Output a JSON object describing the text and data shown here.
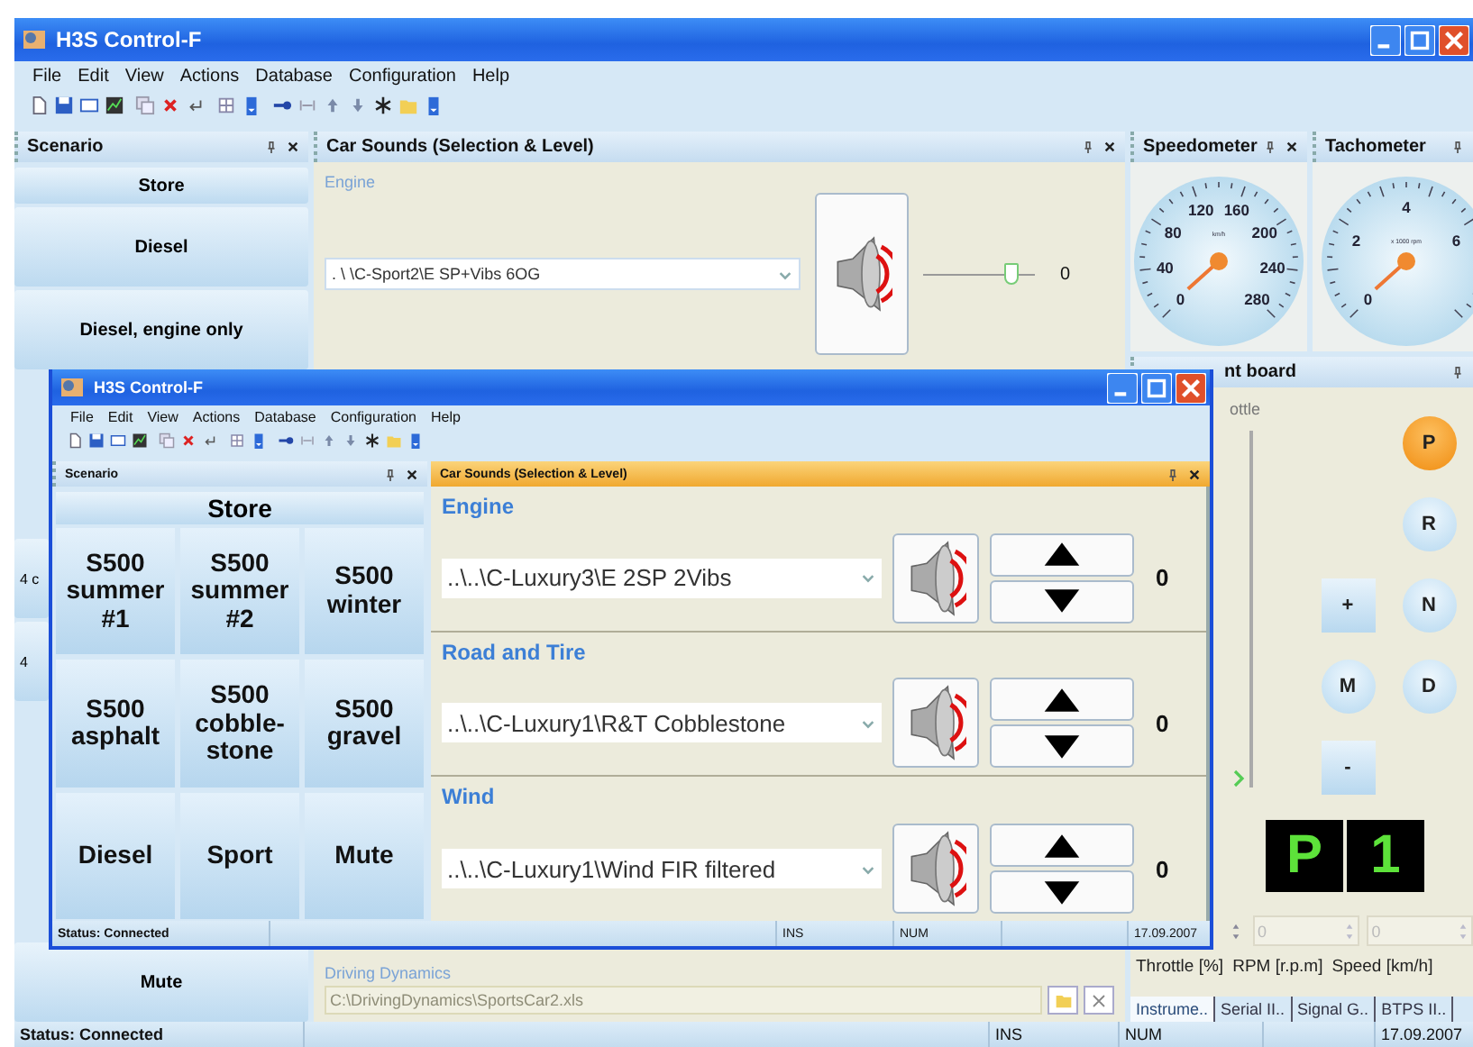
{
  "window": {
    "title": "H3S Control-F"
  },
  "menu": [
    "File",
    "Edit",
    "View",
    "Actions",
    "Database",
    "Configuration",
    "Help"
  ],
  "scenario_panel": {
    "title": "Scenario",
    "buttons": [
      {
        "label": "Store",
        "kind": "store"
      },
      {
        "label": "Diesel",
        "kind": "preset"
      },
      {
        "label": "Diesel, engine only",
        "kind": "preset"
      },
      {
        "label": "4 c",
        "kind": "partial"
      },
      {
        "label": "4",
        "kind": "partial"
      },
      {
        "label": "Mute",
        "kind": "last"
      }
    ]
  },
  "car_sounds_panel": {
    "title": "Car Sounds  (Selection & Level)",
    "channels": [
      {
        "name": "Engine",
        "file": ". \\ \\C-Sport2\\E SP+Vibs 6OG",
        "level": 0.85,
        "reading": "0"
      }
    ],
    "driving_dynamics": {
      "label": "Driving Dynamics",
      "path": "C:\\DrivingDynamics\\SportsCar2.xls"
    }
  },
  "speedometer": {
    "title": "Speedometer",
    "unit": "km/h",
    "labels": [
      "0",
      "40",
      "80",
      "120",
      "160",
      "200",
      "240",
      "280"
    ]
  },
  "tachometer": {
    "title": "Tachometer",
    "unit": "x 1000 rpm",
    "labels": [
      "0",
      "2",
      "4",
      "6"
    ]
  },
  "instrument_board": {
    "title": "nt board",
    "throttle": {
      "label": "ottle",
      "level": 0
    },
    "gear_buttons": [
      {
        "label": "P",
        "kind": "round",
        "selected": true
      },
      {
        "label": "R",
        "kind": "round",
        "selected": false
      },
      {
        "label": "+",
        "kind": "square",
        "selected": false
      },
      {
        "label": "N",
        "kind": "round",
        "selected": false
      },
      {
        "label": "M",
        "kind": "round",
        "selected": false
      },
      {
        "label": "D",
        "kind": "round",
        "selected": false
      },
      {
        "label": "-",
        "kind": "square",
        "selected": false
      }
    ],
    "display": [
      "P",
      "1"
    ],
    "fields": [
      {
        "value": "0"
      },
      {
        "value": "0"
      }
    ],
    "field_labels": [
      "Throttle [%]",
      "RPM [r.p.m]",
      "Speed [km/h]"
    ],
    "tabs": [
      {
        "label": "Instrume..",
        "selected": true
      },
      {
        "label": "Serial II..",
        "selected": false
      },
      {
        "label": "Signal G..",
        "selected": false
      },
      {
        "label": "BTPS II..",
        "selected": false
      }
    ]
  },
  "status_bar": {
    "status": "Status: Connected",
    "cells": [
      "INS",
      "NUM",
      "17.09.2007"
    ]
  },
  "front_window": {
    "title": "H3S Control-F",
    "menu": [
      "File",
      "Edit",
      "View",
      "Actions",
      "Database",
      "Configuration",
      "Help"
    ],
    "scenario_panel": {
      "title": "Scenario",
      "store": "Store",
      "buttons": [
        "S500\nsummer\n#1",
        "S500\nsummer\n#2",
        "S500\nwinter",
        "S500\nasphalt",
        "S500\ncobble-\nstone",
        "S500\ngravel",
        "Diesel",
        "Sport",
        "Mute"
      ]
    },
    "car_sounds_panel": {
      "title": "Car Sounds  (Selection & Level)",
      "channels": [
        {
          "name": "Engine",
          "file": "..\\..\\C-Luxury3\\E 2SP 2Vibs",
          "reading": "0"
        },
        {
          "name": "Road and Tire",
          "file": "..\\..\\C-Luxury1\\R&T Cobblestone",
          "reading": "0"
        },
        {
          "name": "Wind",
          "file": "..\\..\\C-Luxury1\\Wind FIR filtered",
          "reading": "0"
        }
      ]
    },
    "status_bar": {
      "status": "Status: Connected",
      "cells": [
        "INS",
        "NUM",
        "17.09.2007"
      ]
    }
  }
}
